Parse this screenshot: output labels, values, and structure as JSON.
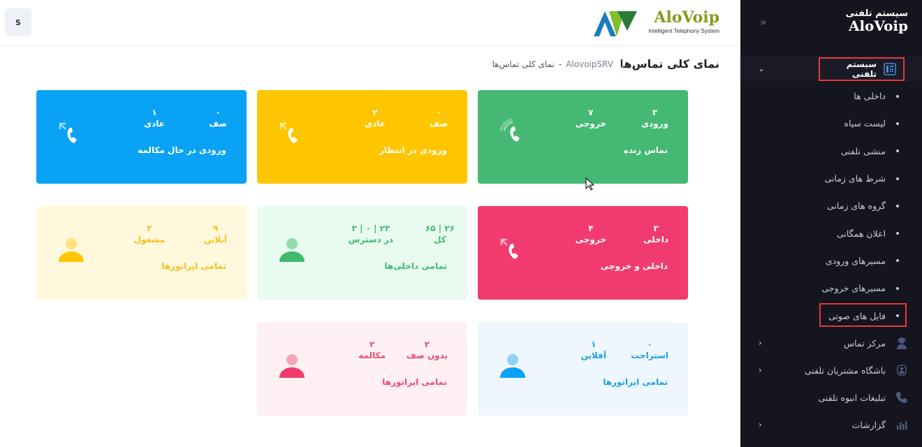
{
  "sidebar": {
    "logo_fa": "سیستم تلفنی",
    "logo_en": "AloVoip",
    "collapse": "«",
    "group": {
      "label": "سیستم تلفنی",
      "icon": "phone-panel-icon"
    },
    "sub_items": [
      {
        "label": "داخلی ها"
      },
      {
        "label": "لیست سیاه"
      },
      {
        "label": "منشی تلفنی"
      },
      {
        "label": "شرط های زمانی"
      },
      {
        "label": "گروه های زمانی"
      },
      {
        "label": "اعلان همگانی"
      },
      {
        "label": "مسیرهای ورودی"
      },
      {
        "label": "مسیرهای خروجی"
      },
      {
        "label": "فایل های صوتی"
      }
    ],
    "main_items": [
      {
        "label": "مرکز تماس",
        "icon": "headset-agent-icon"
      },
      {
        "label": "باشگاه مشتریان تلفنی",
        "icon": "customers-club-icon"
      },
      {
        "label": "تبلیغات انبوه تلفنی",
        "icon": "phone-icon"
      },
      {
        "label": "گزارشات",
        "icon": "bar-chart-icon"
      }
    ]
  },
  "header": {
    "avatar_letter": "S",
    "brand_name": "AloVoip",
    "brand_tagline": "Intelligent Telephony System"
  },
  "subheader": {
    "title": "نمای کلی تماس‌ها",
    "crumb_home": "AlovoipSRV",
    "crumb_sep": "-",
    "crumb_current": "نمای کلی تماس‌ها"
  },
  "cards": {
    "live": {
      "title": "تماس زنده",
      "s1_v": "۳",
      "s1_l": "ورودی",
      "s2_v": "۷",
      "s2_l": "خروجی"
    },
    "waiting": {
      "title": "ورودی در انتظار",
      "s1_v": "۰",
      "s1_l": "صف",
      "s2_v": "۲",
      "s2_l": "عادی"
    },
    "talking": {
      "title": "ورودی در حال مکالمه",
      "s1_v": "۰",
      "s1_l": "صف",
      "s2_v": "۱",
      "s2_l": "عادی"
    },
    "inout": {
      "title": "داخلی و خروجی",
      "s1_v": "۳",
      "s1_l": "داخلی",
      "s2_v": "۴",
      "s2_l": "خروجی"
    },
    "extensions": {
      "title": "تمامی داخلی‌ها",
      "s1_v": "۲۶ | ۶۵",
      "s1_l": "کل",
      "s2_v": "۲۳ | ۰ | ۳",
      "s2_l": "در دسترس"
    },
    "operators_a": {
      "title": "تمامی اپراتورها",
      "s1_v": "۹",
      "s1_l": "آنلاین",
      "s2_v": "۳",
      "s2_l": "مشغول"
    },
    "operators_b": {
      "title": "تمامی اپراتورها",
      "s1_v": "۰",
      "s1_l": "استراحت",
      "s2_v": "۱",
      "s2_l": "آفلاین"
    },
    "operators_c": {
      "title": "تمامی اپراتورها",
      "s1_v": "۲",
      "s1_l": "بدون صف",
      "s2_v": "۲",
      "s2_l": "مکالمه"
    }
  },
  "colors": {
    "green": "#45b974",
    "yellow": "#fec600",
    "blue": "#0aa2f5",
    "red": "#f13b6e",
    "highlight_border": "#e23b3b",
    "sidebar_bg": "#14151e"
  }
}
